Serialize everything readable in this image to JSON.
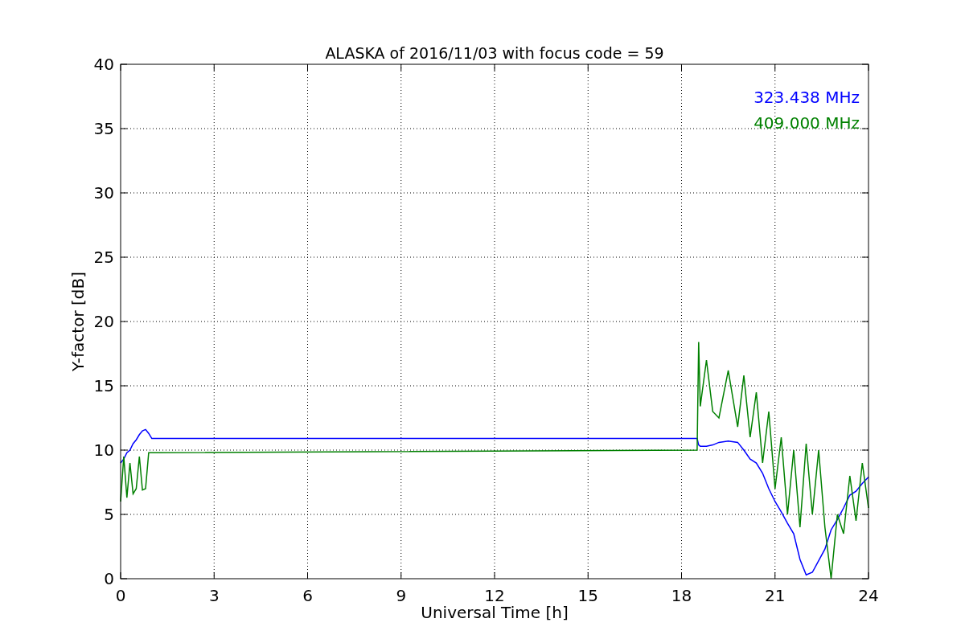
{
  "chart": {
    "chart_data": {
      "type": "line",
      "grid": true,
      "title": "ALASKA of 2016/11/03 with focus code = 59",
      "xlabel": "Universal Time [h]",
      "ylabel": "Y-factor [dB]",
      "xlim": [
        0,
        24
      ],
      "ylim": [
        0,
        40
      ],
      "xticks": [
        0,
        3,
        6,
        9,
        12,
        15,
        18,
        21,
        24
      ],
      "yticks": [
        0,
        5,
        10,
        15,
        20,
        25,
        30,
        35,
        40
      ],
      "x": [
        0,
        0.1,
        0.2,
        0.3,
        0.4,
        0.5,
        0.6,
        0.7,
        0.8,
        0.9,
        1.0,
        1.1,
        18.5,
        18.55,
        18.6,
        18.8,
        19,
        19.2,
        19.5,
        19.8,
        20,
        20.2,
        20.4,
        20.6,
        20.8,
        21,
        21.2,
        21.4,
        21.6,
        21.8,
        22,
        22.2,
        22.4,
        22.6,
        22.8,
        23,
        23.2,
        23.4,
        23.6,
        23.8,
        24
      ],
      "series": [
        {
          "name": "323.438 MHz",
          "color": "#0000ff",
          "values": [
            9.0,
            9.3,
            9.8,
            10.0,
            10.5,
            10.8,
            11.2,
            11.5,
            11.6,
            11.3,
            10.9,
            10.9,
            10.9,
            10.4,
            10.3,
            10.3,
            10.4,
            10.6,
            10.7,
            10.6,
            10.0,
            9.3,
            9.0,
            8.2,
            7.0,
            6.0,
            5.2,
            4.3,
            3.5,
            1.5,
            0.3,
            0.5,
            1.4,
            2.3,
            3.8,
            4.6,
            5.5,
            6.5,
            6.8,
            7.4,
            7.9
          ]
        },
        {
          "name": "409.000 MHz",
          "color": "#008000",
          "values": [
            6.0,
            9.5,
            6.3,
            9.0,
            6.6,
            7.0,
            9.5,
            6.9,
            7.0,
            9.8,
            9.8,
            9.8,
            10.0,
            18.4,
            13.4,
            17.0,
            13.0,
            12.5,
            16.2,
            11.8,
            15.8,
            11.0,
            14.5,
            9.0,
            13.0,
            7.0,
            11.0,
            5.0,
            10.0,
            4.0,
            10.5,
            5.0,
            10.0,
            4.0,
            0.0,
            5.0,
            3.5,
            8.0,
            4.5,
            9.0,
            5.5
          ]
        }
      ]
    }
  }
}
